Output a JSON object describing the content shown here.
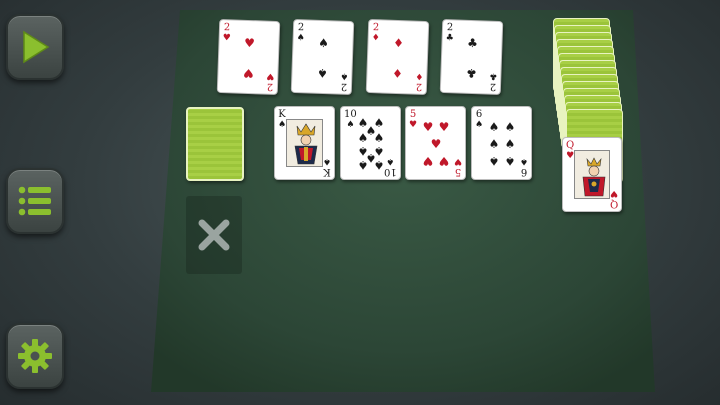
{
  "controls": {
    "play_icon": "play-icon",
    "menu_icon": "menu-list-icon",
    "settings_icon": "gear-icon",
    "accent": "#8bbf2e"
  },
  "colors": {
    "felt": "#2f4a39",
    "card_back": "#a3ca40",
    "suit_red": "#c0182a",
    "suit_black": "#1a1a1a"
  },
  "foundations": [
    {
      "rank": "2",
      "suit": "♥",
      "color": "red"
    },
    {
      "rank": "2",
      "suit": "♠",
      "color": "black"
    },
    {
      "rank": "2",
      "suit": "♦",
      "color": "red"
    },
    {
      "rank": "2",
      "suit": "♣",
      "color": "black"
    }
  ],
  "tableau": [
    {
      "rank": "K",
      "suit": "♠",
      "color": "black",
      "face": true
    },
    {
      "rank": "10",
      "suit": "♠",
      "color": "black"
    },
    {
      "rank": "5",
      "suit": "♥",
      "color": "red"
    },
    {
      "rank": "6",
      "suit": "♠",
      "color": "black"
    }
  ],
  "reserve_top": {
    "rank": "Q",
    "suit": "♥",
    "color": "red",
    "face": true
  },
  "discard_icon": "close-x-icon"
}
